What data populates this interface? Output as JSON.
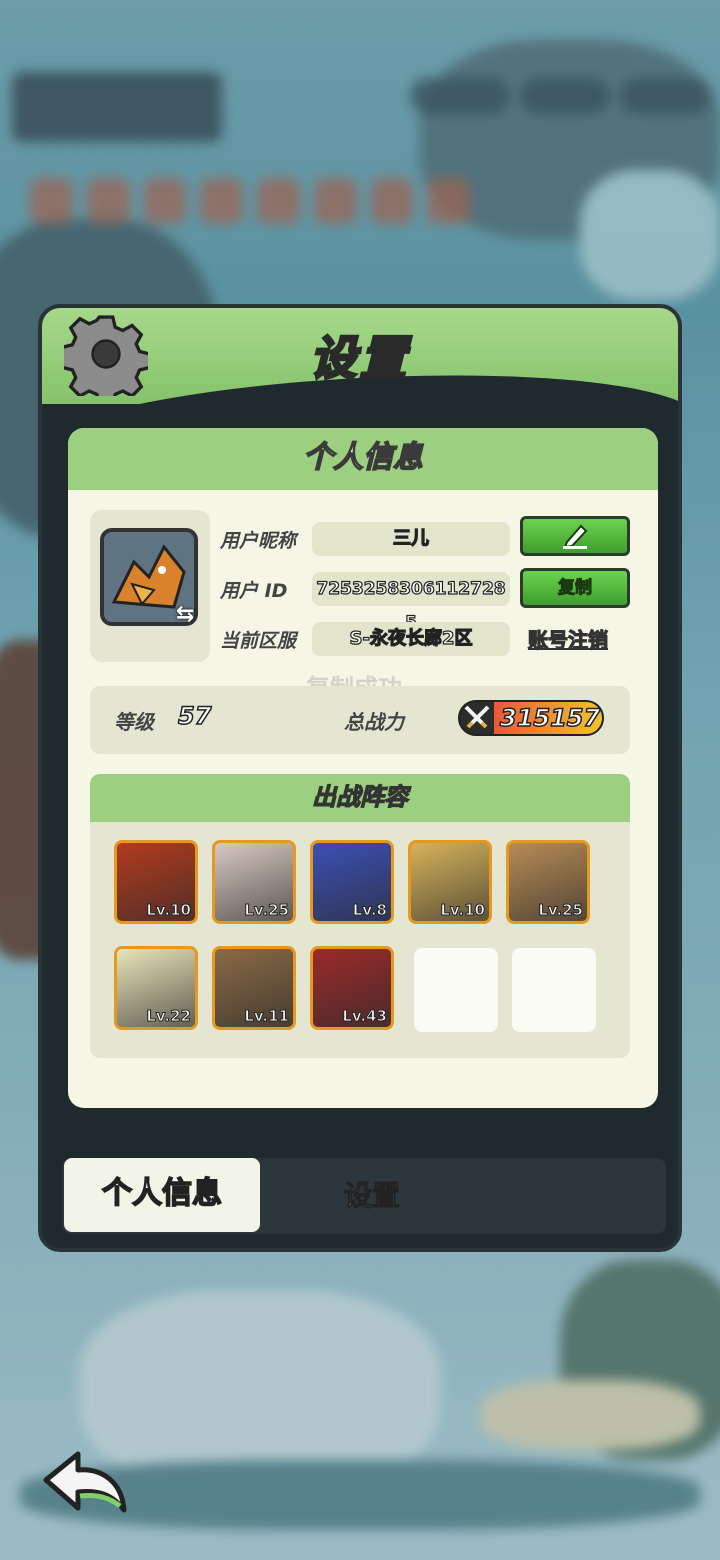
{
  "panel": {
    "title": "设置"
  },
  "profile": {
    "header": "个人信息",
    "nickname_label": "用户昵称",
    "nickname": "三儿",
    "id_label": "用户 ID",
    "user_id": "7253258306112728​5",
    "server_label": "当前区服",
    "server": "S-永夜长廊2区",
    "copy_label": "复制",
    "logout_label": "账号注销",
    "faded_toast": "复制成功"
  },
  "stats": {
    "level_label": "等级",
    "level": "57",
    "power_label": "总战力",
    "power": "315157"
  },
  "lineup": {
    "header": "出战阵容",
    "heroes": [
      {
        "lv": "Lv.10",
        "color": "#b33a1e"
      },
      {
        "lv": "Lv.25",
        "color": "#d9c9c1"
      },
      {
        "lv": "Lv.8",
        "color": "#3b4fb5"
      },
      {
        "lv": "Lv.10",
        "color": "#d7b25a"
      },
      {
        "lv": "Lv.25",
        "color": "#b88b55"
      },
      {
        "lv": "Lv.22",
        "color": "#e9e3b8"
      },
      {
        "lv": "Lv.11",
        "color": "#8a6a44"
      },
      {
        "lv": "Lv.43",
        "color": "#9b2a2a"
      }
    ]
  },
  "tabs": {
    "active": "个人信息",
    "other": "设置"
  },
  "icons": [
    "gear-icon",
    "edit-pencil-icon",
    "swap-icon",
    "sword-icon",
    "back-arrow-icon"
  ],
  "colors": {
    "accent_green": "#9ccf80",
    "panel_dark": "#1f2a2f",
    "button_green": "#4fb63b"
  }
}
